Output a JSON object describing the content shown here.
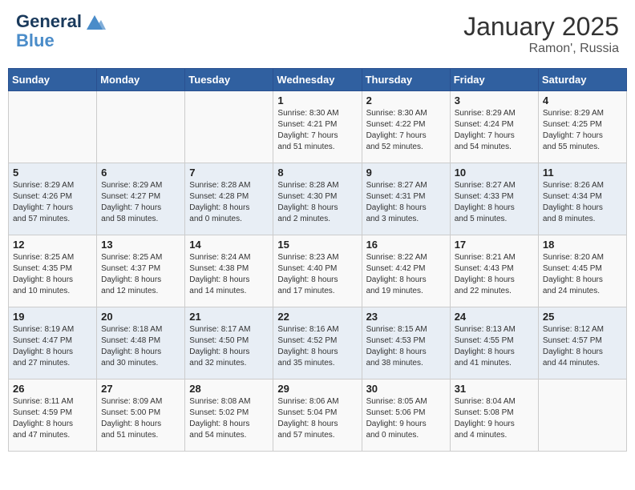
{
  "header": {
    "logo_line1": "General",
    "logo_line2": "Blue",
    "month": "January 2025",
    "location": "Ramon', Russia"
  },
  "weekdays": [
    "Sunday",
    "Monday",
    "Tuesday",
    "Wednesday",
    "Thursday",
    "Friday",
    "Saturday"
  ],
  "weeks": [
    [
      {
        "day": "",
        "content": ""
      },
      {
        "day": "",
        "content": ""
      },
      {
        "day": "",
        "content": ""
      },
      {
        "day": "1",
        "content": "Sunrise: 8:30 AM\nSunset: 4:21 PM\nDaylight: 7 hours\nand 51 minutes."
      },
      {
        "day": "2",
        "content": "Sunrise: 8:30 AM\nSunset: 4:22 PM\nDaylight: 7 hours\nand 52 minutes."
      },
      {
        "day": "3",
        "content": "Sunrise: 8:29 AM\nSunset: 4:24 PM\nDaylight: 7 hours\nand 54 minutes."
      },
      {
        "day": "4",
        "content": "Sunrise: 8:29 AM\nSunset: 4:25 PM\nDaylight: 7 hours\nand 55 minutes."
      }
    ],
    [
      {
        "day": "5",
        "content": "Sunrise: 8:29 AM\nSunset: 4:26 PM\nDaylight: 7 hours\nand 57 minutes."
      },
      {
        "day": "6",
        "content": "Sunrise: 8:29 AM\nSunset: 4:27 PM\nDaylight: 7 hours\nand 58 minutes."
      },
      {
        "day": "7",
        "content": "Sunrise: 8:28 AM\nSunset: 4:28 PM\nDaylight: 8 hours\nand 0 minutes."
      },
      {
        "day": "8",
        "content": "Sunrise: 8:28 AM\nSunset: 4:30 PM\nDaylight: 8 hours\nand 2 minutes."
      },
      {
        "day": "9",
        "content": "Sunrise: 8:27 AM\nSunset: 4:31 PM\nDaylight: 8 hours\nand 3 minutes."
      },
      {
        "day": "10",
        "content": "Sunrise: 8:27 AM\nSunset: 4:33 PM\nDaylight: 8 hours\nand 5 minutes."
      },
      {
        "day": "11",
        "content": "Sunrise: 8:26 AM\nSunset: 4:34 PM\nDaylight: 8 hours\nand 8 minutes."
      }
    ],
    [
      {
        "day": "12",
        "content": "Sunrise: 8:25 AM\nSunset: 4:35 PM\nDaylight: 8 hours\nand 10 minutes."
      },
      {
        "day": "13",
        "content": "Sunrise: 8:25 AM\nSunset: 4:37 PM\nDaylight: 8 hours\nand 12 minutes."
      },
      {
        "day": "14",
        "content": "Sunrise: 8:24 AM\nSunset: 4:38 PM\nDaylight: 8 hours\nand 14 minutes."
      },
      {
        "day": "15",
        "content": "Sunrise: 8:23 AM\nSunset: 4:40 PM\nDaylight: 8 hours\nand 17 minutes."
      },
      {
        "day": "16",
        "content": "Sunrise: 8:22 AM\nSunset: 4:42 PM\nDaylight: 8 hours\nand 19 minutes."
      },
      {
        "day": "17",
        "content": "Sunrise: 8:21 AM\nSunset: 4:43 PM\nDaylight: 8 hours\nand 22 minutes."
      },
      {
        "day": "18",
        "content": "Sunrise: 8:20 AM\nSunset: 4:45 PM\nDaylight: 8 hours\nand 24 minutes."
      }
    ],
    [
      {
        "day": "19",
        "content": "Sunrise: 8:19 AM\nSunset: 4:47 PM\nDaylight: 8 hours\nand 27 minutes."
      },
      {
        "day": "20",
        "content": "Sunrise: 8:18 AM\nSunset: 4:48 PM\nDaylight: 8 hours\nand 30 minutes."
      },
      {
        "day": "21",
        "content": "Sunrise: 8:17 AM\nSunset: 4:50 PM\nDaylight: 8 hours\nand 32 minutes."
      },
      {
        "day": "22",
        "content": "Sunrise: 8:16 AM\nSunset: 4:52 PM\nDaylight: 8 hours\nand 35 minutes."
      },
      {
        "day": "23",
        "content": "Sunrise: 8:15 AM\nSunset: 4:53 PM\nDaylight: 8 hours\nand 38 minutes."
      },
      {
        "day": "24",
        "content": "Sunrise: 8:13 AM\nSunset: 4:55 PM\nDaylight: 8 hours\nand 41 minutes."
      },
      {
        "day": "25",
        "content": "Sunrise: 8:12 AM\nSunset: 4:57 PM\nDaylight: 8 hours\nand 44 minutes."
      }
    ],
    [
      {
        "day": "26",
        "content": "Sunrise: 8:11 AM\nSunset: 4:59 PM\nDaylight: 8 hours\nand 47 minutes."
      },
      {
        "day": "27",
        "content": "Sunrise: 8:09 AM\nSunset: 5:00 PM\nDaylight: 8 hours\nand 51 minutes."
      },
      {
        "day": "28",
        "content": "Sunrise: 8:08 AM\nSunset: 5:02 PM\nDaylight: 8 hours\nand 54 minutes."
      },
      {
        "day": "29",
        "content": "Sunrise: 8:06 AM\nSunset: 5:04 PM\nDaylight: 8 hours\nand 57 minutes."
      },
      {
        "day": "30",
        "content": "Sunrise: 8:05 AM\nSunset: 5:06 PM\nDaylight: 9 hours\nand 0 minutes."
      },
      {
        "day": "31",
        "content": "Sunrise: 8:04 AM\nSunset: 5:08 PM\nDaylight: 9 hours\nand 4 minutes."
      },
      {
        "day": "",
        "content": ""
      }
    ]
  ]
}
